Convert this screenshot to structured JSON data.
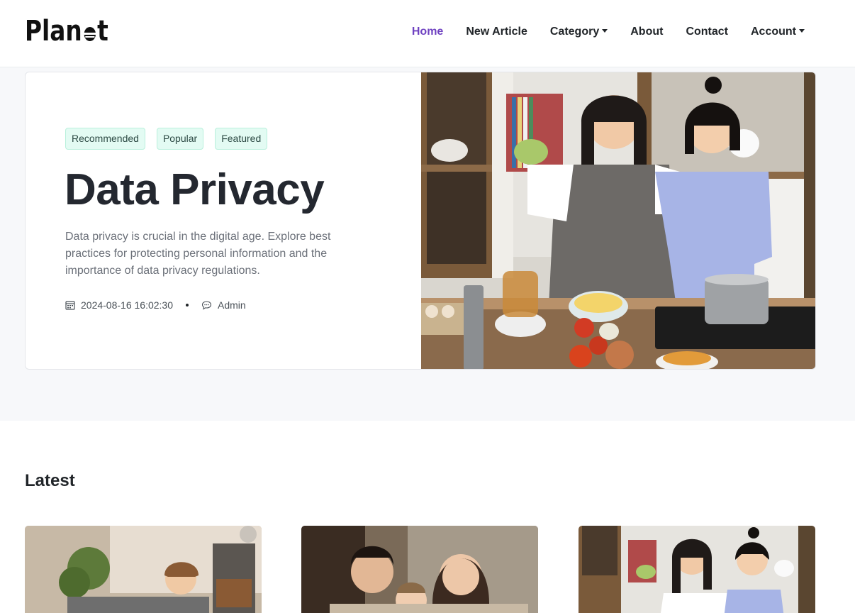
{
  "logo": {
    "text_before": "Plan",
    "text_after": "t"
  },
  "nav": {
    "items": [
      {
        "label": "Home",
        "active": true,
        "dropdown": false
      },
      {
        "label": "New Article",
        "active": false,
        "dropdown": false
      },
      {
        "label": "Category",
        "active": false,
        "dropdown": true
      },
      {
        "label": "About",
        "active": false,
        "dropdown": false
      },
      {
        "label": "Contact",
        "active": false,
        "dropdown": false
      },
      {
        "label": "Account",
        "active": false,
        "dropdown": true
      }
    ]
  },
  "hero": {
    "tags": [
      "Recommended",
      "Popular",
      "Featured"
    ],
    "title": "Data Privacy",
    "description": "Data privacy is crucial in the digital age. Explore best practices for protecting personal information and the importance of data privacy regulations.",
    "date": "2024-08-16 16:02:30",
    "author": "Admin",
    "image_icon": "kitchen-cooking-photo"
  },
  "latest": {
    "title": "Latest",
    "cards": [
      {
        "image_icon": "person-on-sofa-photo"
      },
      {
        "image_icon": "family-photo"
      },
      {
        "image_icon": "kitchen-cooking-photo"
      }
    ]
  },
  "colors": {
    "accent": "#6f42c1",
    "tag_bg": "#e3fbf3",
    "hero_bg": "#f7f8fa",
    "text_dark": "#242830",
    "text_muted": "#6b7079"
  }
}
